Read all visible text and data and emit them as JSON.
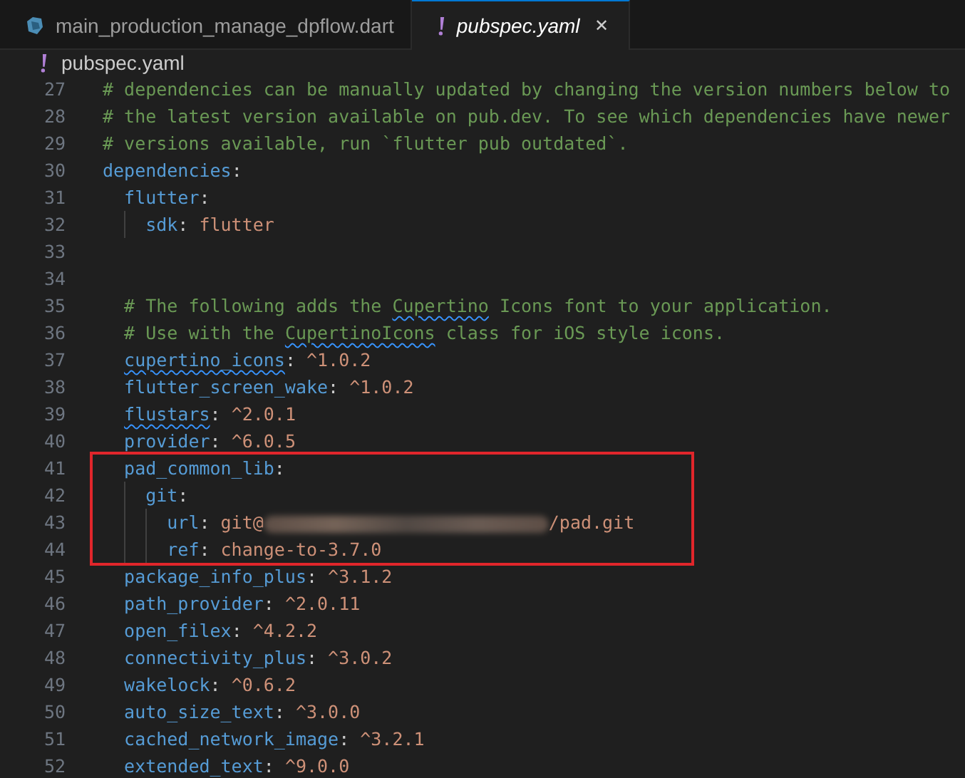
{
  "tabs": [
    {
      "label": "main_production_manage_dpflow.dart",
      "kind": "dart",
      "selected": false
    },
    {
      "label": "pubspec.yaml",
      "kind": "yaml",
      "selected": true,
      "close": "✕"
    }
  ],
  "breadcrumb": {
    "kind": "yaml",
    "label": "pubspec.yaml"
  },
  "lines": [
    {
      "number": "27",
      "highlighted": false,
      "tokens": [
        {
          "kind": "comment",
          "text": "# dependencies can be manually updated by changing the version numbers below to"
        }
      ]
    },
    {
      "number": "28",
      "highlighted": false,
      "tokens": [
        {
          "kind": "comment",
          "text": "# the latest version available on pub.dev. To see which dependencies have newer"
        }
      ]
    },
    {
      "number": "29",
      "highlighted": false,
      "tokens": [
        {
          "kind": "comment",
          "text": "# versions available, run `flutter pub outdated`."
        }
      ]
    },
    {
      "number": "30",
      "highlighted": false,
      "tokens": [
        {
          "kind": "key",
          "text": "dependencies"
        },
        {
          "kind": "punct",
          "text": ":"
        }
      ],
      "children": [
        {
          "number": "31",
          "highlighted": false,
          "tokens": [
            {
              "kind": "key",
              "text": "flutter"
            },
            {
              "kind": "punct",
              "text": ":"
            }
          ],
          "children": [
            {
              "number": "32",
              "highlighted": false,
              "tokens": [
                {
                  "kind": "key",
                  "text": "sdk"
                },
                {
                  "kind": "punct",
                  "text": ": "
                },
                {
                  "kind": "value",
                  "text": "flutter"
                }
              ]
            }
          ]
        },
        {
          "number": "33",
          "highlighted": false
        },
        {
          "number": "34",
          "highlighted": false
        },
        {
          "number": "35",
          "highlighted": false,
          "tokens": [
            {
              "kind": "comment",
              "text": "# The following adds the "
            },
            {
              "kind": "comment",
              "text": "Cupertino",
              "squiggly": true
            },
            {
              "kind": "comment",
              "text": " Icons font to your application."
            }
          ]
        },
        {
          "number": "36",
          "highlighted": false,
          "tokens": [
            {
              "kind": "comment",
              "text": "# Use with the "
            },
            {
              "kind": "comment",
              "text": "CupertinoIcons",
              "squiggly": true
            },
            {
              "kind": "comment",
              "text": " class for iOS style icons."
            }
          ]
        },
        {
          "number": "37",
          "highlighted": false,
          "tokens": [
            {
              "kind": "key",
              "text": "cupertino_icons",
              "squiggly": true
            },
            {
              "kind": "punct",
              "text": ": "
            },
            {
              "kind": "value",
              "text": "^1.0.2"
            }
          ]
        },
        {
          "number": "38",
          "highlighted": false,
          "tokens": [
            {
              "kind": "key",
              "text": "flutter_screen_wake"
            },
            {
              "kind": "punct",
              "text": ": "
            },
            {
              "kind": "value",
              "text": "^1.0.2"
            }
          ]
        },
        {
          "number": "39",
          "highlighted": false,
          "tokens": [
            {
              "kind": "key",
              "text": "flustars",
              "squiggly": true
            },
            {
              "kind": "punct",
              "text": ": "
            },
            {
              "kind": "value",
              "text": "^2.0.1"
            }
          ]
        },
        {
          "number": "40",
          "highlighted": false,
          "tokens": [
            {
              "kind": "key",
              "text": "provider"
            },
            {
              "kind": "punct",
              "text": ": "
            },
            {
              "kind": "value",
              "text": "^6.0.5"
            }
          ]
        },
        {
          "number": "41",
          "highlighted": true,
          "tokens": [
            {
              "kind": "key",
              "text": "pad_common_lib"
            },
            {
              "kind": "punct",
              "text": ":"
            }
          ],
          "children": [
            {
              "number": "42",
              "highlighted": true,
              "tokens": [
                {
                  "kind": "key",
                  "text": "git"
                },
                {
                  "kind": "punct",
                  "text": ":"
                }
              ],
              "children": [
                {
                  "number": "43",
                  "highlighted": true,
                  "tokens": [
                    {
                      "kind": "key",
                      "text": "url"
                    },
                    {
                      "kind": "punct",
                      "text": ": "
                    },
                    {
                      "kind": "value",
                      "text": "git@"
                    },
                    {
                      "kind": "redacted"
                    },
                    {
                      "kind": "value",
                      "text": "/pad.git"
                    }
                  ]
                },
                {
                  "number": "44",
                  "highlighted": true,
                  "tokens": [
                    {
                      "kind": "key",
                      "text": "ref"
                    },
                    {
                      "kind": "punct",
                      "text": ": "
                    },
                    {
                      "kind": "value",
                      "text": "change-to-3.7.0"
                    }
                  ]
                }
              ]
            }
          ]
        },
        {
          "number": "45",
          "highlighted": false,
          "tokens": [
            {
              "kind": "key",
              "text": "package_info_plus"
            },
            {
              "kind": "punct",
              "text": ": "
            },
            {
              "kind": "value",
              "text": "^3.1.2"
            }
          ]
        },
        {
          "number": "46",
          "highlighted": false,
          "tokens": [
            {
              "kind": "key",
              "text": "path_provider"
            },
            {
              "kind": "punct",
              "text": ": "
            },
            {
              "kind": "value",
              "text": "^2.0.11"
            }
          ]
        },
        {
          "number": "47",
          "highlighted": false,
          "tokens": [
            {
              "kind": "key",
              "text": "open_filex"
            },
            {
              "kind": "punct",
              "text": ": "
            },
            {
              "kind": "value",
              "text": "^4.2.2"
            }
          ]
        },
        {
          "number": "48",
          "highlighted": false,
          "tokens": [
            {
              "kind": "key",
              "text": "connectivity_plus"
            },
            {
              "kind": "punct",
              "text": ": "
            },
            {
              "kind": "value",
              "text": "^3.0.2"
            }
          ]
        },
        {
          "number": "49",
          "highlighted": false,
          "tokens": [
            {
              "kind": "key",
              "text": "wakelock"
            },
            {
              "kind": "punct",
              "text": ": "
            },
            {
              "kind": "value",
              "text": "^0.6.2"
            }
          ]
        },
        {
          "number": "50",
          "highlighted": false,
          "tokens": [
            {
              "kind": "key",
              "text": "auto_size_text"
            },
            {
              "kind": "punct",
              "text": ": "
            },
            {
              "kind": "value",
              "text": "^3.0.0"
            }
          ]
        },
        {
          "number": "51",
          "highlighted": false,
          "tokens": [
            {
              "kind": "key",
              "text": "cached_network_image"
            },
            {
              "kind": "punct",
              "text": ": "
            },
            {
              "kind": "value",
              "text": "^3.2.1"
            }
          ]
        },
        {
          "number": "52",
          "highlighted": false,
          "tokens": [
            {
              "kind": "key",
              "text": "extended_text"
            },
            {
              "kind": "punct",
              "text": ": "
            },
            {
              "kind": "value",
              "text": "^9.0.0"
            }
          ]
        }
      ]
    }
  ]
}
